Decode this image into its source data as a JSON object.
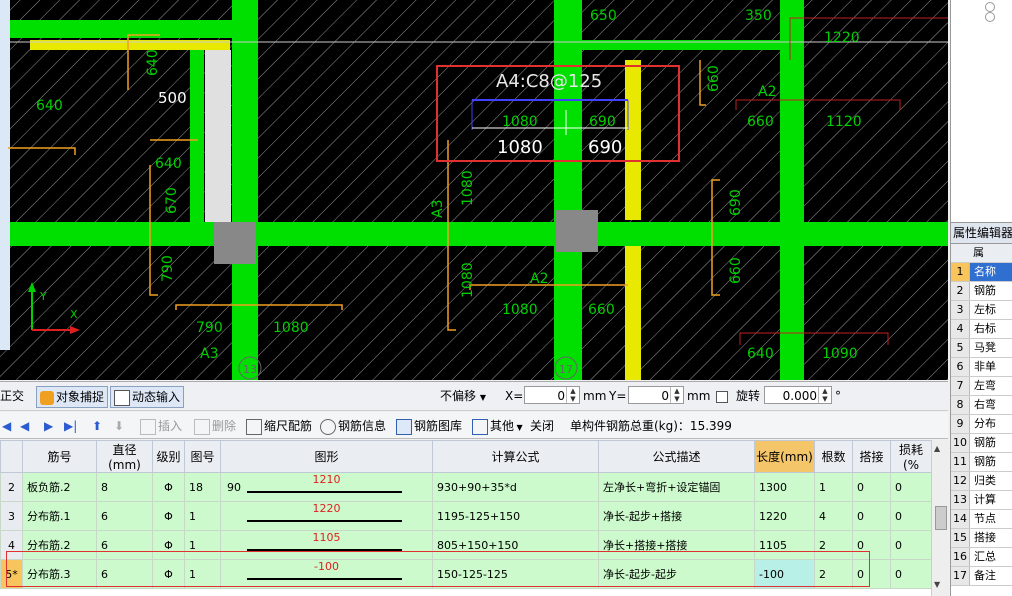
{
  "canvas": {
    "labels": {
      "top_500": "500",
      "top_640_left": "640",
      "top_640_a": "640",
      "top_640_b": "640",
      "side_670": "670",
      "side_790": "790",
      "a3": "A3",
      "a3_790": "790",
      "a3_1080": "1080",
      "a3_vert": "A3",
      "vert_1080_a": "1080",
      "vert_1080_b": "1080",
      "a2_mid": "A2",
      "a2_1080": "1080",
      "a2_660": "660",
      "top_650": "650",
      "top_350": "350",
      "right_1220": "1220",
      "right_a2": "A2",
      "right_660": "660",
      "right_1120": "1120",
      "right_660_v": "660",
      "right_690_v": "690",
      "right_660_v2": "660",
      "right_640": "640",
      "right_1090": "1090",
      "sel_title": "A4:C8@125",
      "sel_1080_small": "1080",
      "sel_690_small": "690",
      "sel_1080": "1080",
      "sel_690": "690",
      "axis_y": "Y",
      "axis_x": "X",
      "marker_left": "13",
      "marker_mid": "17"
    }
  },
  "toolbar1": {
    "ortho": "正交",
    "snap": "对象捕捉",
    "dyn_input": "动态输入",
    "offset_mode": "不偏移",
    "x_label": "X=",
    "x_value": "0",
    "mm1": "mm",
    "y_label": "Y=",
    "y_value": "0",
    "mm2": "mm",
    "rotate": "旋转",
    "rotate_value": "0.000",
    "deg": "°"
  },
  "toolbar2": {
    "insert": "插入",
    "delete": "删除",
    "scale_rebar": "缩尺配筋",
    "rebar_info": "钢筋信息",
    "rebar_lib": "钢筋图库",
    "other": "其他",
    "close": "关闭",
    "total_weight": "单构件钢筋总重(kg)：15.399"
  },
  "table": {
    "headers": [
      "筋号",
      "直径(mm)",
      "级别",
      "图号",
      "图形",
      "计算公式",
      "公式描述",
      "长度(mm)",
      "根数",
      "搭接",
      "损耗(%"
    ],
    "rows": [
      {
        "rn": "2",
        "name": "板负筋.2",
        "dia": "8",
        "grade": "Φ",
        "fig": "18",
        "shape_left": "90",
        "shape_val": "1210",
        "formula": "930+90+35*d",
        "desc": "左净长+弯折+设定锚固",
        "len": "1300",
        "count": "1",
        "lap": "0",
        "loss": "0"
      },
      {
        "rn": "3",
        "name": "分布筋.1",
        "dia": "6",
        "grade": "Φ",
        "fig": "1",
        "shape_left": "",
        "shape_val": "1220",
        "formula": "1195-125+150",
        "desc": "净长-起步+搭接",
        "len": "1220",
        "count": "4",
        "lap": "0",
        "loss": "0"
      },
      {
        "rn": "4",
        "name": "分布筋.2",
        "dia": "6",
        "grade": "Φ",
        "fig": "1",
        "shape_left": "",
        "shape_val": "1105",
        "formula": "805+150+150",
        "desc": "净长+搭接+搭接",
        "len": "1105",
        "count": "2",
        "lap": "0",
        "loss": "0"
      },
      {
        "rn": "5*",
        "name": "分布筋.3",
        "dia": "6",
        "grade": "Φ",
        "fig": "1",
        "shape_left": "",
        "shape_val": "-100",
        "formula": "150-125-125",
        "desc": "净长-起步-起步",
        "len": "-100",
        "count": "2",
        "lap": "0",
        "loss": "0"
      }
    ]
  },
  "props": {
    "title": "属性编辑器",
    "header": "属",
    "rows": [
      {
        "n": "1",
        "t": "名称"
      },
      {
        "n": "2",
        "t": "钢筋"
      },
      {
        "n": "3",
        "t": "左标"
      },
      {
        "n": "4",
        "t": "右标"
      },
      {
        "n": "5",
        "t": "马凳"
      },
      {
        "n": "6",
        "t": "非单"
      },
      {
        "n": "7",
        "t": "左弯"
      },
      {
        "n": "8",
        "t": "右弯"
      },
      {
        "n": "9",
        "t": "分布"
      },
      {
        "n": "10",
        "t": "钢筋"
      },
      {
        "n": "11",
        "t": "钢筋"
      },
      {
        "n": "12",
        "t": "归类"
      },
      {
        "n": "13",
        "t": "计算"
      },
      {
        "n": "14",
        "t": "节点"
      },
      {
        "n": "15",
        "t": "搭接"
      },
      {
        "n": "16",
        "t": "汇总"
      },
      {
        "n": "17",
        "t": "备注"
      }
    ]
  },
  "colors": {
    "green": "#00e000",
    "yellow": "#e8e800",
    "red": "#e03030",
    "orange": "#f0a020",
    "canvas_bg": "#000000"
  }
}
